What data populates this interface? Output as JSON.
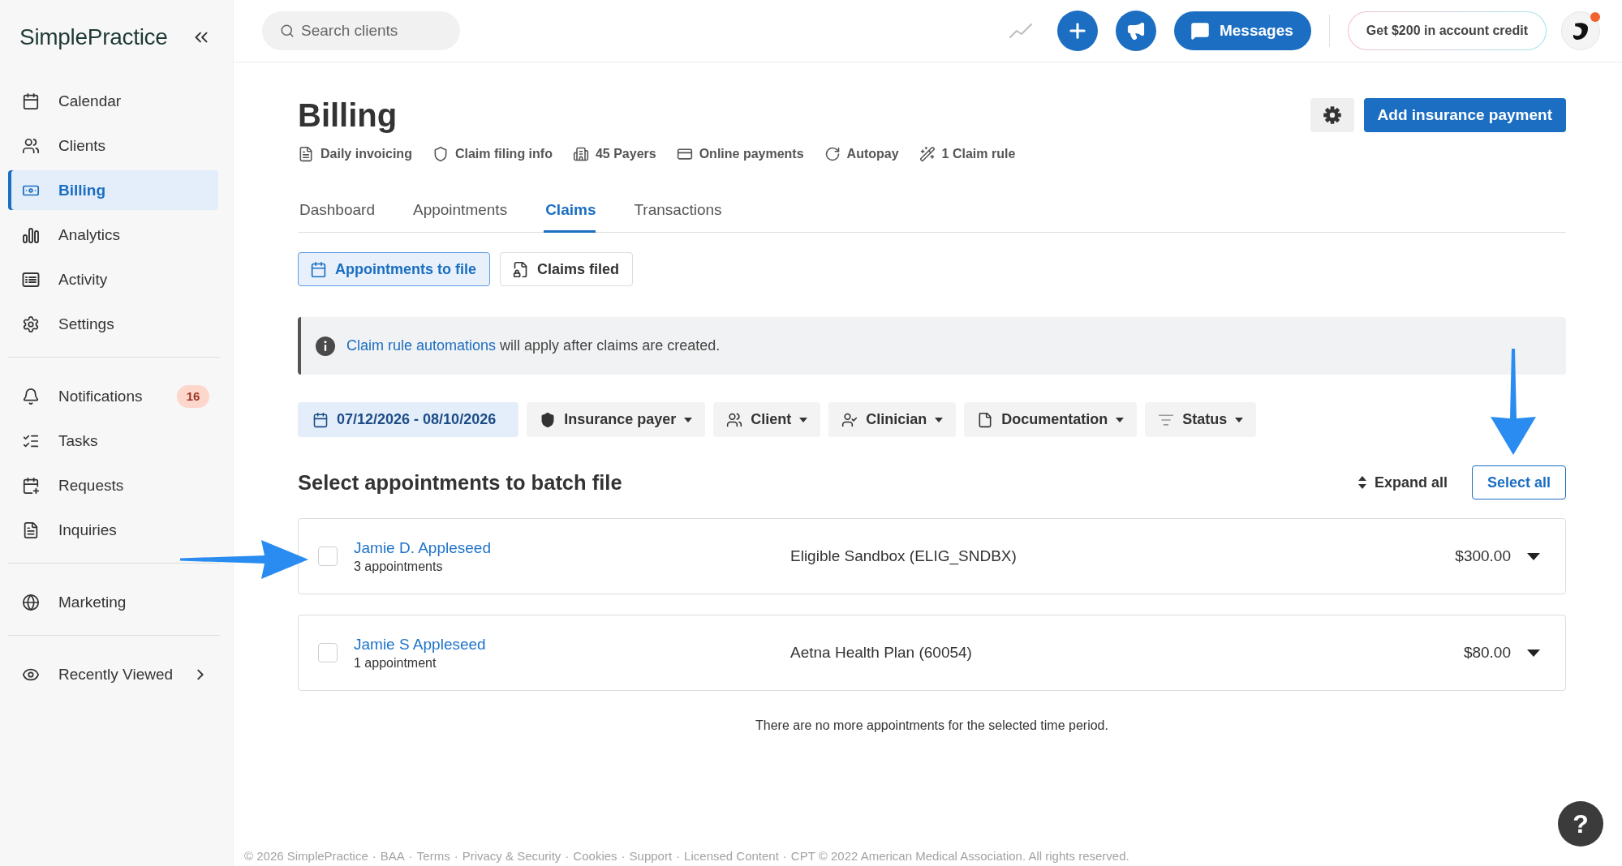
{
  "sidebar": {
    "logo": "SimplePractice",
    "groups": [
      {
        "items": [
          {
            "label": "Calendar",
            "selected": false,
            "kind": "page"
          },
          {
            "label": "Clients",
            "selected": false,
            "kind": "page"
          },
          {
            "label": "Billing",
            "selected": true,
            "kind": "page"
          },
          {
            "label": "Analytics",
            "selected": false,
            "kind": "page"
          },
          {
            "label": "Activity",
            "selected": false,
            "kind": "page"
          },
          {
            "label": "Settings",
            "selected": false,
            "kind": "page"
          }
        ]
      },
      {
        "items": [
          {
            "label": "Notifications",
            "selected": false,
            "kind": "page",
            "badge": "16"
          },
          {
            "label": "Tasks",
            "selected": false,
            "kind": "page"
          },
          {
            "label": "Requests",
            "selected": false,
            "kind": "page"
          },
          {
            "label": "Inquiries",
            "selected": false,
            "kind": "page"
          }
        ]
      },
      {
        "items": [
          {
            "label": "Marketing",
            "selected": false,
            "kind": "page"
          }
        ]
      },
      {
        "items": [
          {
            "label": "Recently Viewed",
            "selected": false,
            "kind": "flyout"
          }
        ]
      }
    ]
  },
  "topbar": {
    "search": {
      "placeholder": "Search clients"
    },
    "messages_button": "Messages",
    "credit_button": "Get $200 in account credit",
    "avatar": {
      "unread": true
    }
  },
  "header": {
    "title": "Billing",
    "primary_button": "Add insurance payment",
    "info_links": [
      "Daily invoicing",
      "Claim filing info",
      "45 Payers",
      "Online payments",
      "Autopay",
      "1 Claim rule"
    ]
  },
  "tabs": [
    {
      "label": "Dashboard",
      "selected": false
    },
    {
      "label": "Appointments",
      "selected": false
    },
    {
      "label": "Claims",
      "selected": true
    },
    {
      "label": "Transactions",
      "selected": false
    }
  ],
  "views": [
    {
      "label": "Appointments to file",
      "selected": true
    },
    {
      "label": "Claims filed",
      "selected": false
    }
  ],
  "banner": {
    "link": "Claim rule automations",
    "text": "will apply after claims are created."
  },
  "filters": [
    {
      "kind": "date",
      "label": "07/12/2026 - 08/10/2026",
      "active": true
    },
    {
      "kind": "dropdown",
      "label": "Insurance payer",
      "active": false
    },
    {
      "kind": "dropdown",
      "label": "Client",
      "active": false
    },
    {
      "kind": "dropdown",
      "label": "Clinician",
      "active": false
    },
    {
      "kind": "dropdown",
      "label": "Documentation",
      "active": false
    },
    {
      "kind": "dropdown",
      "label": "Status",
      "active": false
    }
  ],
  "batch": {
    "title": "Select appointments to batch file",
    "expand_all": "Expand all",
    "select_all": "Select all",
    "rows": [
      {
        "name": "Jamie D. Appleseed",
        "appointments": "3 appointments",
        "payer": "Eligible Sandbox (ELIG_SNDBX)",
        "amount": "$300.00",
        "checked": false
      },
      {
        "name": "Jamie S Appleseed",
        "appointments": "1 appointment",
        "payer": "Aetna Health Plan (60054)",
        "amount": "$80.00",
        "checked": false
      }
    ],
    "empty_note": "There are no more appointments for the selected time period."
  },
  "footer": {
    "separator": "·",
    "items": [
      "© 2026 SimplePractice",
      "BAA",
      "Terms",
      "Privacy & Security",
      "Cookies",
      "Support",
      "Licensed Content",
      "CPT © 2022 American Medical Association. All rights reserved."
    ]
  },
  "help_button": "?"
}
